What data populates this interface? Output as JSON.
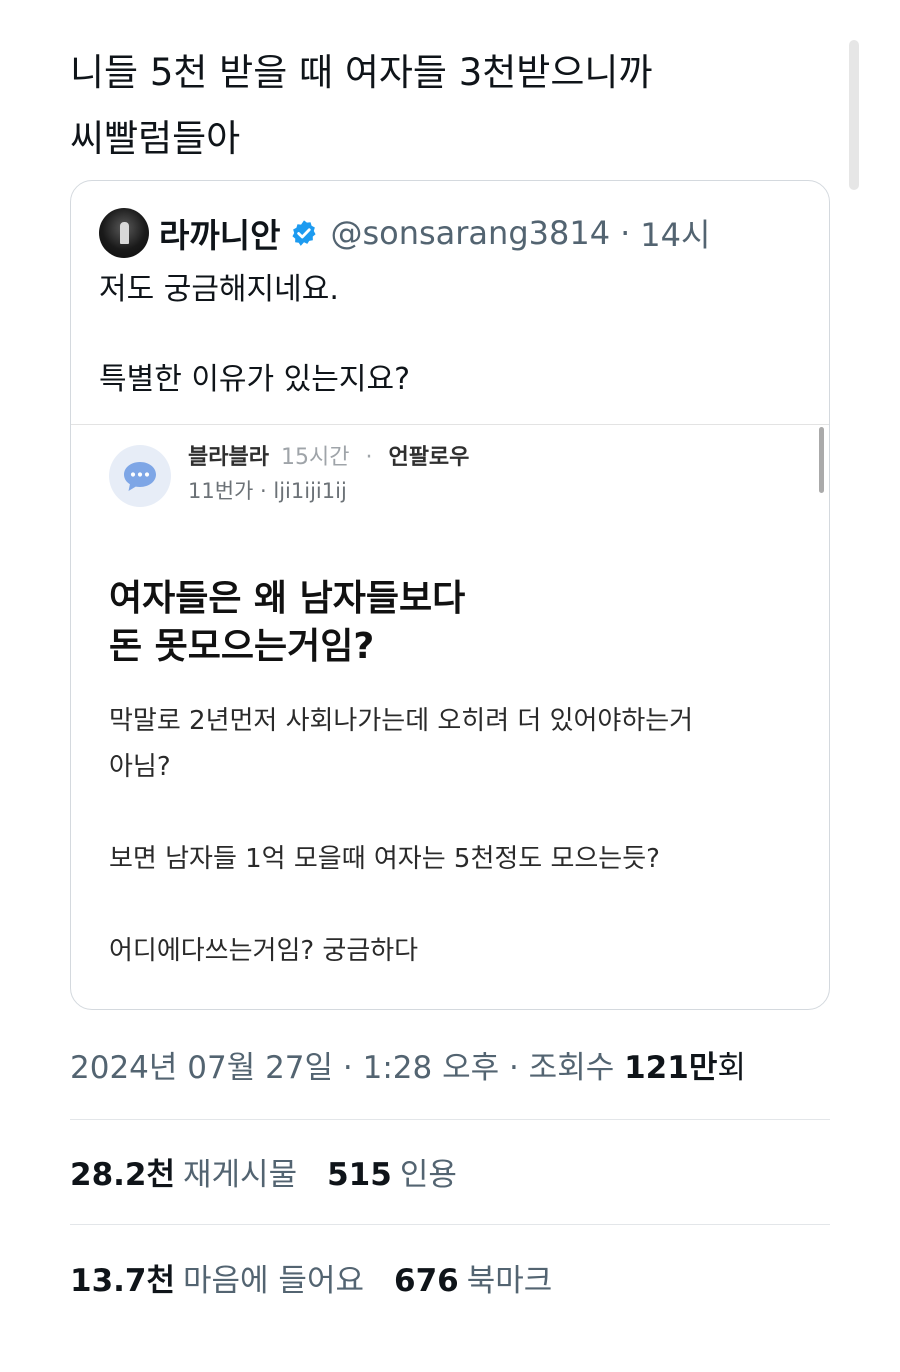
{
  "tweet": {
    "text_lines": [
      "니들 5천 받을 때 여자들 3천받으니까",
      "씨빨럼들아"
    ],
    "timestamp": "2024년 07월 27일 · 1:28 오후 · 조회수 ",
    "views_number": "121만",
    "views_unit": "회",
    "stats": {
      "retweets_count": "28.2천",
      "retweets_label": "재게시물",
      "quotes_count": "515",
      "quotes_label": "인용",
      "likes_count": "13.7천",
      "likes_label": "마음에 들어요",
      "bookmarks_count": "676",
      "bookmarks_label": "북마크"
    }
  },
  "quoted_tweet": {
    "name": "라까니안",
    "handle": "@sonsarang3814",
    "separator": "·",
    "time": "14시",
    "body_lines": [
      "저도 궁금해지네요.",
      "특별한 이유가 있는지요?"
    ]
  },
  "blind_post": {
    "author": "블라블라",
    "time": "15시간",
    "separator": "·",
    "board": "언팔로우",
    "sub_line": "11번가 · lji1iji1ij",
    "title_lines": [
      "여자들은 왜 남자들보다",
      "돈 못모으는거임?"
    ],
    "body": [
      "막말로 2년먼저 사회나가는데 오히려 더 있어야하는거",
      "아님?",
      "보면 남자들 1억 모을때 여자는 5천정도 모으는듯?",
      "어디에다쓰는거임? 궁금하다"
    ]
  },
  "icons": {
    "verified": "verified-badge-icon",
    "blind_avatar": "speech-bubble-icon"
  },
  "colors": {
    "verified_blue": "#1d9bf0",
    "secondary_text": "#536471",
    "blind_avatar_bg": "#e7edf7",
    "blind_bubble": "#7ea6e6"
  }
}
